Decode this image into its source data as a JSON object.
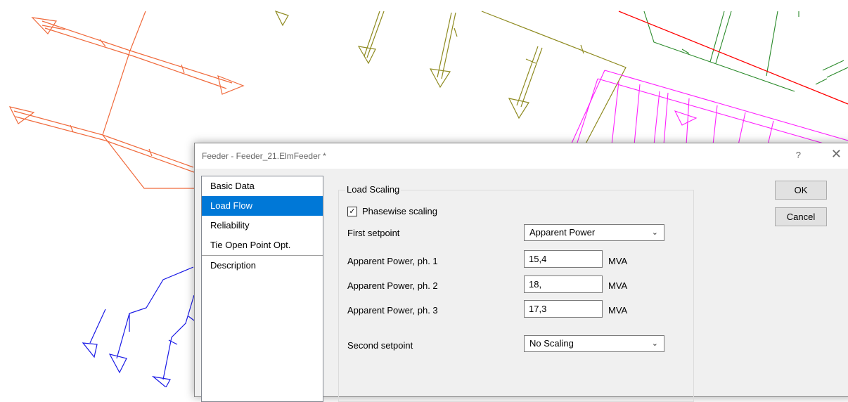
{
  "dialog": {
    "title": "Feeder - Feeder_21.ElmFeeder *",
    "help_icon": "?",
    "close_icon": "✕"
  },
  "nav": {
    "items": [
      {
        "label": "Basic Data"
      },
      {
        "label": "Load Flow",
        "selected": true
      },
      {
        "label": "Reliability"
      },
      {
        "label": "Tie Open Point Opt."
      },
      {
        "label": "Description"
      }
    ]
  },
  "load_scaling": {
    "group_label": "Load Scaling",
    "phasewise_label": "Phasewise scaling",
    "phasewise_checked": true,
    "phasewise_mark": "✓",
    "first_setpoint_label": "First setpoint",
    "first_setpoint_value": "Apparent Power",
    "ph1_label": "Apparent Power, ph. 1",
    "ph1_value": "15,4",
    "ph1_unit": "MVA",
    "ph2_label": "Apparent Power, ph. 2",
    "ph2_value": "18,",
    "ph2_unit": "MVA",
    "ph3_label": "Apparent Power, ph. 3",
    "ph3_value": "17,3",
    "ph3_unit": "MVA",
    "second_setpoint_label": "Second setpoint",
    "second_setpoint_value": "No Scaling"
  },
  "buttons": {
    "ok": "OK",
    "cancel": "Cancel"
  },
  "colors": {
    "selection": "#0078d7",
    "network_orange": "#f06a3c",
    "network_olive": "#8e8a1f",
    "network_magenta": "#ff20ff",
    "network_green": "#2a8a2a",
    "network_red": "#ff0000",
    "network_blue": "#1a1ae6"
  }
}
